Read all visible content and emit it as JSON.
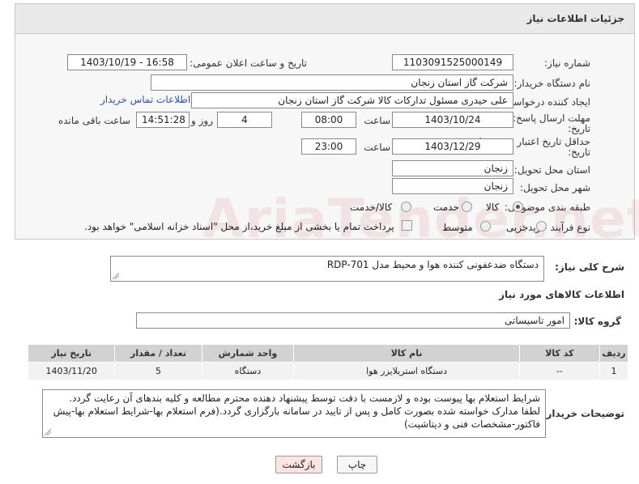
{
  "header": {
    "title": "جزئیات اطلاعات نیاز"
  },
  "form": {
    "need_number": {
      "label": "شماره نیاز:",
      "value": "1103091525000149"
    },
    "announce_datetime": {
      "label": "تاریخ و ساعت اعلان عمومی:",
      "value": "1403/10/19 - 16:58"
    },
    "buyer_org": {
      "label": "نام دستگاه خریدار:",
      "value": "شرکت گاز استان زنجان"
    },
    "requester": {
      "label": "ایجاد کننده درخواست:",
      "value": "علی حیدری مسئول تدارکات کالا شرکت گاز استان زنجان",
      "contact_link": "اطلاعات تماس خریدار"
    },
    "reply_deadline": {
      "label_line1": "مهلت ارسال پاسخ: تا",
      "label_line2": "تاریخ:",
      "date": "1403/10/24",
      "time_label": "ساعت",
      "time": "08:00",
      "days": "4",
      "days_label": "روز و",
      "remaining": "14:51:28",
      "remaining_label": "ساعت باقی مانده"
    },
    "price_validity": {
      "label_line1": "حداقل تاریخ اعتبار قیمت: تا",
      "label_line2": "تاریخ:",
      "date": "1403/12/29",
      "time_label": "ساعت",
      "time": "23:00"
    },
    "delivery_province": {
      "label": "استان محل تحویل:",
      "value": "زنجان"
    },
    "delivery_city": {
      "label": "شهر محل تحویل:",
      "value": "زنجان"
    },
    "category": {
      "label": "طبقه بندی موضوعی:",
      "options": [
        "کالا",
        "خدمت",
        "کالا/خدمت"
      ],
      "selected": "کالا"
    },
    "process_type": {
      "label": "نوع فرآیند خرید :",
      "options": [
        "جزیی",
        "متوسط"
      ],
      "selected": "",
      "payment_note": "پرداخت تمام یا بخشی از مبلغ خرید،از محل \"اسناد خزانه اسلامی\" خواهد بود."
    }
  },
  "summary": {
    "label": "شرح کلی نیاز:",
    "value": "دستگاه ضدعفونی کننده هوا و محیط مدل RDP-701"
  },
  "goods_section_title": "اطلاعات کالاهای مورد نیاز",
  "goods_group": {
    "label": "گروه کالا:",
    "value": "امور تاسیساتی"
  },
  "table": {
    "headers": [
      "ردیف",
      "کد کالا",
      "نام کالا",
      "واحد شمارش",
      "تعداد / مقدار",
      "تاریخ نیاز"
    ],
    "rows": [
      [
        "1",
        "--",
        "دستگاه استریلایزر هوا",
        "دستگاه",
        "5",
        "1403/11/20"
      ]
    ]
  },
  "buyer_notes": {
    "label": "توضیحات خریدار:",
    "value": "شرایط استعلام بها پیوست بوده و لازمست با دقت توسط پیشنهاد دهنده محترم مطالعه و کلیه بندهای آن رعایت گردد. لطفا مدارک خواسته شده بصورت کامل و پس از تایید در سامانه بارگزاری گردد.(فرم استعلام بها-شرایط استعلام بها-پیش فاکتور-مشخصات فنی و دیتاشیت)"
  },
  "buttons": {
    "print": "چاپ",
    "back": "بازگشت"
  },
  "watermark": "AriaTender.net",
  "colors": {
    "link": "#2a55b0",
    "back_button_bg": "#fde3e3",
    "header_bg": "#e9e9e9"
  }
}
